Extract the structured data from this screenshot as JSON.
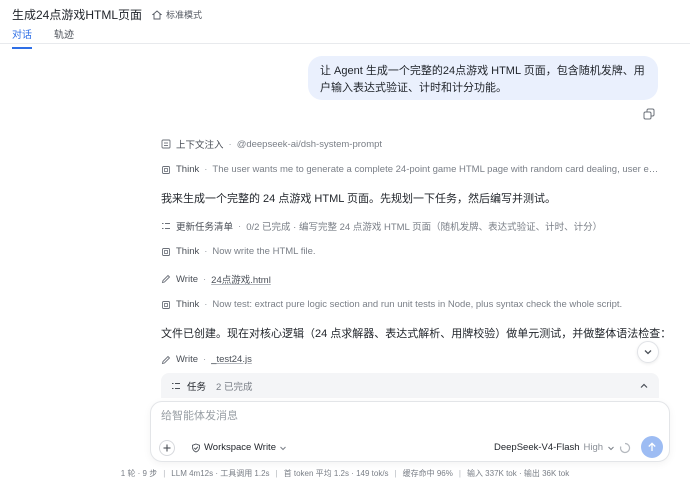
{
  "header": {
    "title": "生成24点游戏HTML页面",
    "mode_label": "标准模式",
    "tabs": [
      {
        "label": "对话",
        "active": true
      },
      {
        "label": "轨迹",
        "active": false
      }
    ]
  },
  "user_message": "让 Agent 生成一个完整的24点游戏 HTML 页面，包含随机发牌、用户输入表达式验证、计时和计分功能。",
  "activities": [
    {
      "icon": "list-icon",
      "name": "上下文注入",
      "desc": "@deepseek-ai/dsh-system-prompt"
    },
    {
      "icon": "think-icon",
      "name": "Think",
      "desc": "The user wants me to generate a complete 24-point game HTML page with random card dealing, user expr..."
    },
    {
      "icon": "checklist-icon",
      "name": "更新任务清单",
      "desc": "0/2 已完成 · 编写完整 24 点游戏 HTML 页面（随机发牌、表达式验证、计时、计分）"
    },
    {
      "icon": "think-icon",
      "name": "Think",
      "desc": "Now write the HTML file."
    },
    {
      "icon": "pencil-icon",
      "name": "Write",
      "link": "24点游戏.html"
    },
    {
      "icon": "think-icon",
      "name": "Think",
      "desc": "Now test: extract pure logic section and run unit tests in Node, plus syntax check the whole script."
    },
    {
      "icon": "pencil-icon",
      "name": "Write",
      "link": "_test24.js"
    }
  ],
  "paragraphs": [
    "我来生成一个完整的 24 点游戏 HTML 页面。先规划一下任务，然后编写并测试。",
    "文件已创建。现在对核心逻辑（24 点求解器、表达式解析、用牌校验）做单元测试，并做整体语法检查："
  ],
  "tasks": {
    "label": "任务",
    "count": "2 已完成"
  },
  "composer": {
    "placeholder": "给智能体发消息",
    "workspace_label": "Workspace Write",
    "model_name": "DeepSeek-V4-Flash",
    "model_level": "High"
  },
  "status": {
    "turns": "1 轮 · 9 步",
    "llm": "LLM 4m12s · 工具调用 1.2s",
    "first_token": "首 token 平均 1.2s · 149 tok/s",
    "cache": "缓存命中 96%",
    "io": "输入 337K tok · 输出 36K tok"
  },
  "colors": {
    "accent": "#2f6fe6",
    "bubble": "#eaf0fd",
    "send": "#9dbcf3"
  }
}
